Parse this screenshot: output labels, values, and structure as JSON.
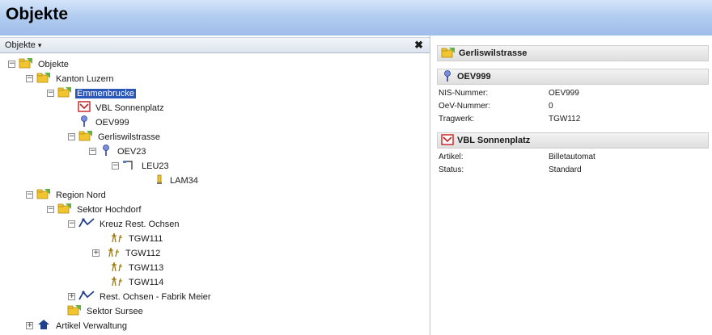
{
  "window": {
    "title": "Objekte"
  },
  "tree_pane": {
    "header_title": "Objekte",
    "header_caret": "▾",
    "close_glyph": "✖",
    "rows": [
      {
        "label": "Objekte",
        "toggle": "−"
      },
      {
        "label": "Kanton Luzern",
        "toggle": "−"
      },
      {
        "label": "Emmenbrucke",
        "toggle": "−"
      },
      {
        "label": "VBL Sonnenplatz",
        "toggle": ""
      },
      {
        "label": "OEV999",
        "toggle": ""
      },
      {
        "label": "Gerliswilstrasse",
        "toggle": "−"
      },
      {
        "label": "OEV23",
        "toggle": "−"
      },
      {
        "label": "LEU23",
        "toggle": "−"
      },
      {
        "label": "LAM34",
        "toggle": ""
      },
      {
        "label": "Region Nord",
        "toggle": "−"
      },
      {
        "label": "Sektor Hochdorf",
        "toggle": "−"
      },
      {
        "label": "Kreuz Rest. Ochsen",
        "toggle": "−"
      },
      {
        "label": "TGW111",
        "toggle": ""
      },
      {
        "label": "TGW112",
        "toggle": "+"
      },
      {
        "label": "TGW113",
        "toggle": ""
      },
      {
        "label": "TGW114",
        "toggle": ""
      },
      {
        "label": "Rest. Ochsen - Fabrik Meier",
        "toggle": "+"
      },
      {
        "label": "Sektor Sursee",
        "toggle": ""
      },
      {
        "label": "Artikel Verwaltung",
        "toggle": "+"
      }
    ]
  },
  "detail_pane": {
    "groups": [
      {
        "title": "Gerliswilstrasse",
        "fields": []
      },
      {
        "title": "OEV999",
        "fields": [
          {
            "key": "NIS-Nummer:",
            "value": "OEV999"
          },
          {
            "key": "OeV-Nummer:",
            "value": "0"
          },
          {
            "key": "Tragwerk:",
            "value": "TGW112"
          }
        ]
      },
      {
        "title": "VBL Sonnenplatz",
        "fields": [
          {
            "key": "Artikel:",
            "value": "Billetautomat"
          },
          {
            "key": "Status:",
            "value": "Standard"
          }
        ]
      }
    ]
  },
  "colors": {
    "title_gradient_top": "#d4e5fa",
    "title_gradient_bottom": "#9dbdeb",
    "selection": "#2b58b8",
    "folder": "#f2c530",
    "folder_leaf": "#63b340"
  }
}
